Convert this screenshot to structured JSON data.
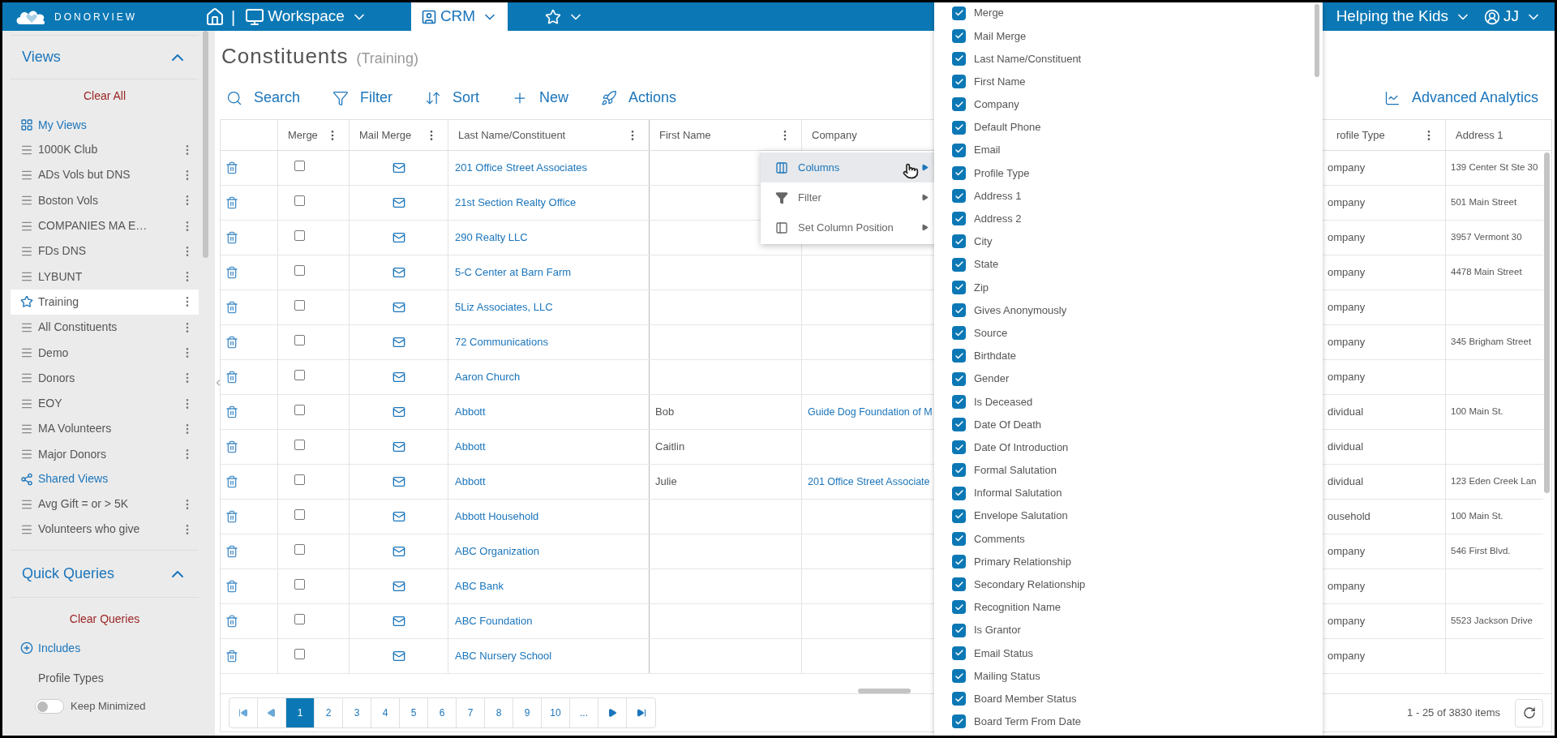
{
  "topbar": {
    "logo": "DONORVIEW",
    "separator": "|",
    "nav": [
      {
        "label": "Workspace",
        "selected": false
      },
      {
        "label": "CRM",
        "selected": true
      }
    ],
    "org": "Helping the Kids",
    "user": "JJ"
  },
  "views": {
    "title": "Views",
    "expanded": true,
    "clear": "Clear All",
    "sections": [
      {
        "kind": "my",
        "label": "My Views",
        "items": [
          {
            "label": "1000K Club",
            "selected": false
          },
          {
            "label": "ADs Vols but DNS",
            "selected": false
          },
          {
            "label": "Boston Vols",
            "selected": false
          },
          {
            "label": "COMPANIES MA E…",
            "selected": false
          },
          {
            "label": "FDs DNS",
            "selected": false
          },
          {
            "label": "LYBUNT",
            "selected": false
          },
          {
            "label": "Training",
            "selected": true
          },
          {
            "label": "All Constituents",
            "selected": false
          },
          {
            "label": "Demo",
            "selected": false
          },
          {
            "label": "Donors",
            "selected": false
          },
          {
            "label": "EOY",
            "selected": false
          },
          {
            "label": "MA Volunteers",
            "selected": false
          },
          {
            "label": "Major Donors",
            "selected": false
          }
        ]
      },
      {
        "kind": "shared",
        "label": "Shared Views",
        "items": [
          {
            "label": "Avg Gift = or > 5K",
            "selected": false
          },
          {
            "label": "Volunteers who give",
            "selected": false
          }
        ]
      }
    ]
  },
  "quick_queries": {
    "title": "Quick Queries",
    "expanded": true,
    "clear": "Clear Queries",
    "includes": "Includes",
    "profile_types": "Profile Types"
  },
  "keep_minimized": {
    "label": "Keep Minimized",
    "on": false
  },
  "page": {
    "title": "Constituents",
    "subtitle": "(Training)"
  },
  "toolbar": [
    {
      "kind": "search",
      "label": "Search"
    },
    {
      "kind": "filter",
      "label": "Filter"
    },
    {
      "kind": "sort",
      "label": "Sort"
    },
    {
      "kind": "new",
      "label": "New"
    },
    {
      "kind": "actions",
      "label": "Actions"
    }
  ],
  "analytics": "Advanced Analytics",
  "table": {
    "columns": [
      {
        "label": "Merge",
        "menu": true
      },
      {
        "label": "Mail Merge",
        "menu": true
      },
      {
        "label": "Last Name/Constituent",
        "menu": true
      },
      {
        "label": "First Name",
        "menu": true
      },
      {
        "label": "Company",
        "menu": false
      },
      {
        "label": "rofile Type",
        "menu": true
      },
      {
        "label": "Address 1",
        "menu": false
      }
    ],
    "rows": [
      {
        "merge": false,
        "last_name": "201 Office Street Associates",
        "profile_type": "ompany",
        "address_1": "139 Center St Ste 30"
      },
      {
        "merge": false,
        "last_name": "21st Section Realty Office",
        "profile_type": "ompany",
        "address_1": "501 Main Street"
      },
      {
        "merge": false,
        "last_name": "290 Realty LLC",
        "profile_type": "ompany",
        "address_1": "3957 Vermont 30"
      },
      {
        "merge": false,
        "last_name": "5-C Center at Barn Farm",
        "profile_type": "ompany",
        "address_1": "4478 Main Street"
      },
      {
        "merge": false,
        "last_name": "5Liz Associates, LLC",
        "profile_type": "ompany"
      },
      {
        "merge": false,
        "last_name": "72 Communications",
        "profile_type": "ompany",
        "address_1": "345 Brigham Street"
      },
      {
        "merge": false,
        "last_name": "Aaron Church",
        "profile_type": "ompany"
      },
      {
        "merge": false,
        "last_name": "Abbott",
        "first_name": "Bob",
        "company": "Guide Dog Foundation of M",
        "profile_type": "dividual",
        "address_1": "100 Main St."
      },
      {
        "merge": false,
        "last_name": "Abbott",
        "first_name": "Caitlin",
        "profile_type": "dividual"
      },
      {
        "merge": false,
        "last_name": "Abbott",
        "first_name": "Julie",
        "company": "201 Office Street Associate",
        "profile_type": "dividual",
        "address_1": "123 Eden Creek Lan"
      },
      {
        "merge": false,
        "last_name": "Abbott Household",
        "profile_type": "ousehold",
        "address_1": "100 Main St."
      },
      {
        "merge": false,
        "last_name": "ABC Organization",
        "profile_type": "ompany",
        "address_1": "546 First Blvd."
      },
      {
        "merge": false,
        "last_name": "ABC Bank",
        "profile_type": "ompany"
      },
      {
        "merge": false,
        "last_name": "ABC Foundation",
        "profile_type": "ompany",
        "address_1": "5523 Jackson Drive"
      },
      {
        "merge": false,
        "last_name": "ABC Nursery School",
        "profile_type": "ompany"
      }
    ]
  },
  "pagination": {
    "pages": [
      {
        "label": "1",
        "selected": true
      },
      {
        "label": "2",
        "selected": false
      },
      {
        "label": "3",
        "selected": false
      },
      {
        "label": "4",
        "selected": false
      },
      {
        "label": "5",
        "selected": false
      },
      {
        "label": "6",
        "selected": false
      },
      {
        "label": "7",
        "selected": false
      },
      {
        "label": "8",
        "selected": false
      },
      {
        "label": "9",
        "selected": false
      },
      {
        "label": "10",
        "selected": false
      },
      {
        "label": "...",
        "selected": false
      }
    ],
    "summary": "1 - 25 of 3830 items"
  },
  "column_menu": [
    {
      "kind": "columns",
      "label": "Columns",
      "selected": true
    },
    {
      "kind": "filter",
      "label": "Filter",
      "selected": false
    },
    {
      "kind": "position",
      "label": "Set Column Position",
      "selected": false
    }
  ],
  "columns_panel": [
    {
      "label": "Merge",
      "checked": true
    },
    {
      "label": "Mail Merge",
      "checked": true
    },
    {
      "label": "Last Name/Constituent",
      "checked": true
    },
    {
      "label": "First Name",
      "checked": true
    },
    {
      "label": "Company",
      "checked": true
    },
    {
      "label": "Default Phone",
      "checked": true
    },
    {
      "label": "Email",
      "checked": true
    },
    {
      "label": "Profile Type",
      "checked": true
    },
    {
      "label": "Address 1",
      "checked": true
    },
    {
      "label": "Address 2",
      "checked": true
    },
    {
      "label": "City",
      "checked": true
    },
    {
      "label": "State",
      "checked": true
    },
    {
      "label": "Zip",
      "checked": true
    },
    {
      "label": "Gives Anonymously",
      "checked": true
    },
    {
      "label": "Source",
      "checked": true
    },
    {
      "label": "Birthdate",
      "checked": true
    },
    {
      "label": "Gender",
      "checked": true
    },
    {
      "label": "Is Deceased",
      "checked": true
    },
    {
      "label": "Date Of Death",
      "checked": true
    },
    {
      "label": "Date Of Introduction",
      "checked": true
    },
    {
      "label": "Formal Salutation",
      "checked": true
    },
    {
      "label": "Informal Salutation",
      "checked": true
    },
    {
      "label": "Envelope Salutation",
      "checked": true
    },
    {
      "label": "Comments",
      "checked": true
    },
    {
      "label": "Primary Relationship",
      "checked": true
    },
    {
      "label": "Secondary Relationship",
      "checked": true
    },
    {
      "label": "Recognition Name",
      "checked": true
    },
    {
      "label": "Is Grantor",
      "checked": true
    },
    {
      "label": "Email Status",
      "checked": true
    },
    {
      "label": "Mailing Status",
      "checked": true
    },
    {
      "label": "Board Member Status",
      "checked": true
    },
    {
      "label": "Board Term From Date",
      "checked": true
    }
  ]
}
